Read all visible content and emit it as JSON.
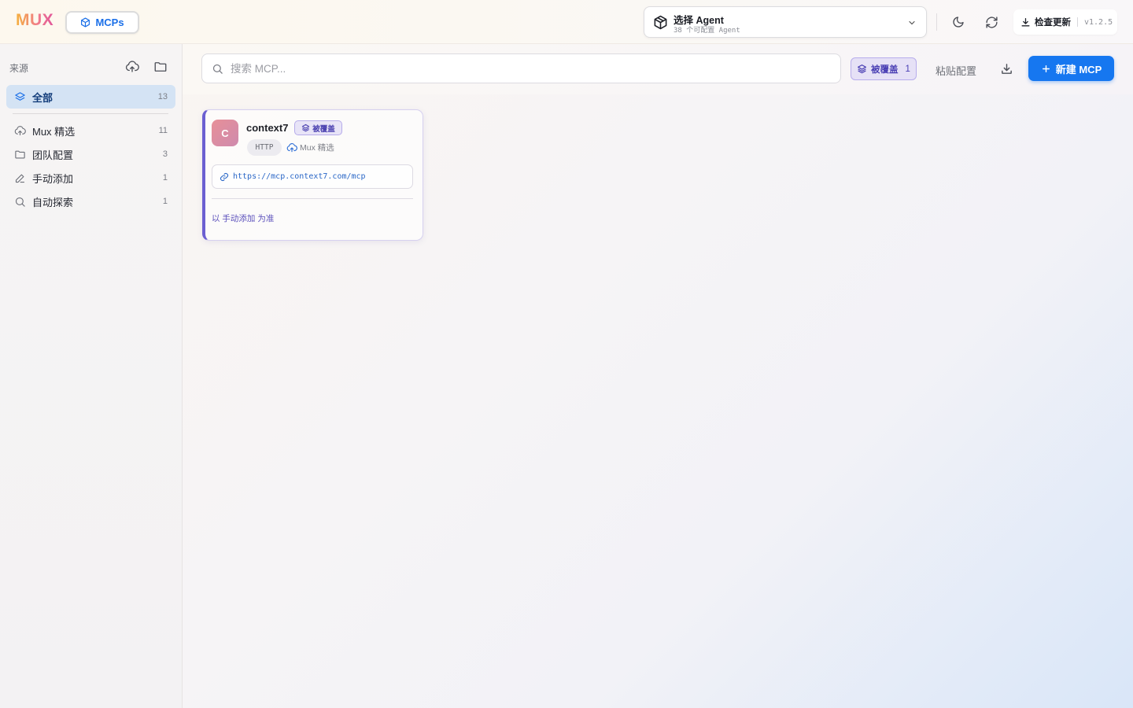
{
  "header": {
    "logo": "MUX",
    "nav_tab": "MCPs",
    "agent_select": {
      "title": "选择 Agent",
      "subtitle": "38 个可配置 Agent"
    },
    "update_button": "检查更新",
    "version": "v1.2.5"
  },
  "sidebar": {
    "heading": "来源",
    "all": {
      "label": "全部",
      "count": "13"
    },
    "items": [
      {
        "label": "Mux 精选",
        "count": "11",
        "icon": "cloud-upload-icon"
      },
      {
        "label": "团队配置",
        "count": "3",
        "icon": "folder-icon"
      },
      {
        "label": "手动添加",
        "count": "1",
        "icon": "pencil-icon"
      },
      {
        "label": "自动探索",
        "count": "1",
        "icon": "search-icon"
      }
    ]
  },
  "toolbar": {
    "search_placeholder": "搜索 MCP...",
    "override_label": "被覆盖",
    "override_count": "1",
    "paste_label": "粘贴配置",
    "new_label": "新建 MCP"
  },
  "cards": [
    {
      "avatar": "C",
      "name": "context7",
      "badge": "被覆盖",
      "transport": "HTTP",
      "source": "Mux 精选",
      "url": "https://mcp.context7.com/mcp",
      "note": "以 手动添加 为准"
    }
  ],
  "colors": {
    "accent": "#1677f0",
    "override": "#6b5fd1",
    "active_bg": "#d4e3f4"
  }
}
